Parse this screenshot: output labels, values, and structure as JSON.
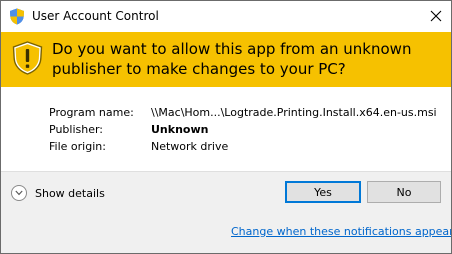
{
  "window": {
    "title": "User Account Control"
  },
  "banner": {
    "question": "Do you want to allow this app from an unknown publisher to make changes to your PC?"
  },
  "details": {
    "program_name_label": "Program name:",
    "program_name_value": "\\\\Mac\\Hom...\\Logtrade.Printing.Install.x64.en-us.msi",
    "publisher_label": "Publisher:",
    "publisher_value": "Unknown",
    "file_origin_label": "File origin:",
    "file_origin_value": "Network drive"
  },
  "footer": {
    "show_details_label": "Show details",
    "yes_label": "Yes",
    "no_label": "No",
    "notifications_link": "Change when these notifications appear"
  },
  "colors": {
    "banner": "#f6c100",
    "link": "#0066cc",
    "focus": "#0078d7"
  },
  "icons": {
    "title": "uac-shield-icon",
    "banner": "warning-shield-icon",
    "close": "close-icon",
    "expand": "chevron-down-icon"
  }
}
